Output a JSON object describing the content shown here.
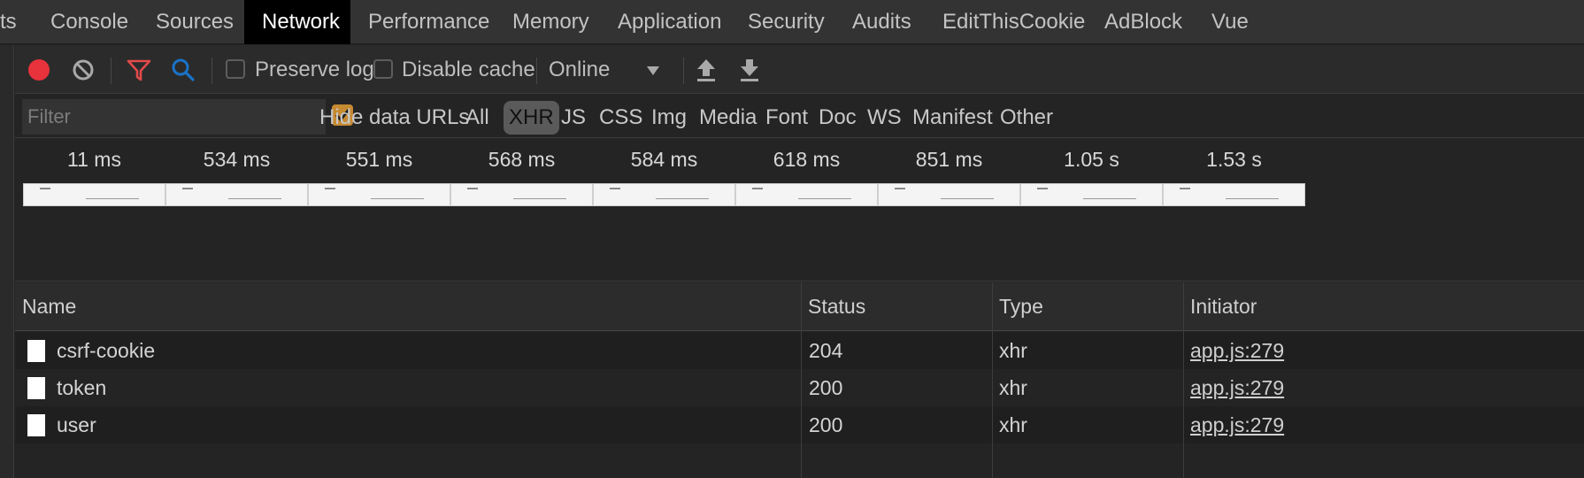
{
  "tabs": [
    {
      "label": "ts"
    },
    {
      "label": "Console"
    },
    {
      "label": "Sources"
    },
    {
      "label": "Network"
    },
    {
      "label": "Performance"
    },
    {
      "label": "Memory"
    },
    {
      "label": "Application"
    },
    {
      "label": "Security"
    },
    {
      "label": "Audits"
    },
    {
      "label": "EditThisCookie"
    },
    {
      "label": "AdBlock"
    },
    {
      "label": "Vue"
    }
  ],
  "active_tab": "Network",
  "toolbar": {
    "preserve_log": "Preserve log",
    "disable_cache": "Disable cache",
    "throttling": "Online",
    "record_color": "#e8323c",
    "filter_icon_color": "#e24a4a",
    "search_icon_color": "#1a73c8"
  },
  "filterbar": {
    "placeholder": "Filter",
    "hide_data_urls": "Hide data URLs",
    "types": [
      {
        "label": "All"
      },
      {
        "label": "XHR"
      },
      {
        "label": "JS"
      },
      {
        "label": "CSS"
      },
      {
        "label": "Img"
      },
      {
        "label": "Media"
      },
      {
        "label": "Font"
      },
      {
        "label": "Doc"
      },
      {
        "label": "WS"
      },
      {
        "label": "Manifest"
      },
      {
        "label": "Other"
      }
    ],
    "active_type": "XHR"
  },
  "screenshots": [
    {
      "time": "11 ms"
    },
    {
      "time": "534 ms"
    },
    {
      "time": "551 ms"
    },
    {
      "time": "568 ms"
    },
    {
      "time": "584 ms"
    },
    {
      "time": "618 ms"
    },
    {
      "time": "851 ms"
    },
    {
      "time": "1.05 s"
    },
    {
      "time": "1.53 s"
    }
  ],
  "table": {
    "columns": [
      "Name",
      "Status",
      "Type",
      "Initiator"
    ],
    "rows": [
      {
        "name": "csrf-cookie",
        "status": "204",
        "type": "xhr",
        "initiator": "app.js:279"
      },
      {
        "name": "token",
        "status": "200",
        "type": "xhr",
        "initiator": "app.js:279"
      },
      {
        "name": "user",
        "status": "200",
        "type": "xhr",
        "initiator": "app.js:279"
      }
    ]
  }
}
